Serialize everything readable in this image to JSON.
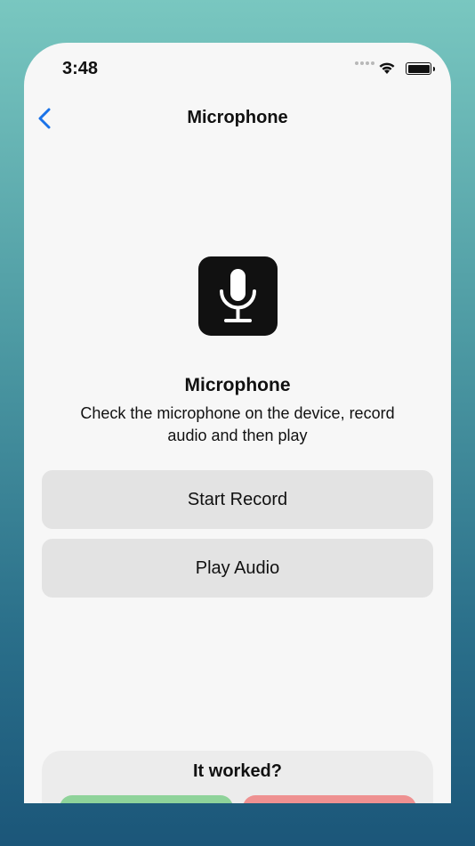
{
  "status_bar": {
    "time": "3:48"
  },
  "nav": {
    "title": "Microphone"
  },
  "feature": {
    "icon": "microphone-icon",
    "title": "Microphone",
    "description": "Check the microphone on the device, record audio and then play"
  },
  "actions": {
    "start_record_label": "Start Record",
    "play_audio_label": "Play Audio"
  },
  "feedback": {
    "question": "It worked?",
    "yes_color": "#8fd39a",
    "no_color": "#ee9191"
  },
  "colors": {
    "accent": "#1a73e8",
    "background": "#f7f7f7",
    "button_bg": "#e3e3e3"
  }
}
